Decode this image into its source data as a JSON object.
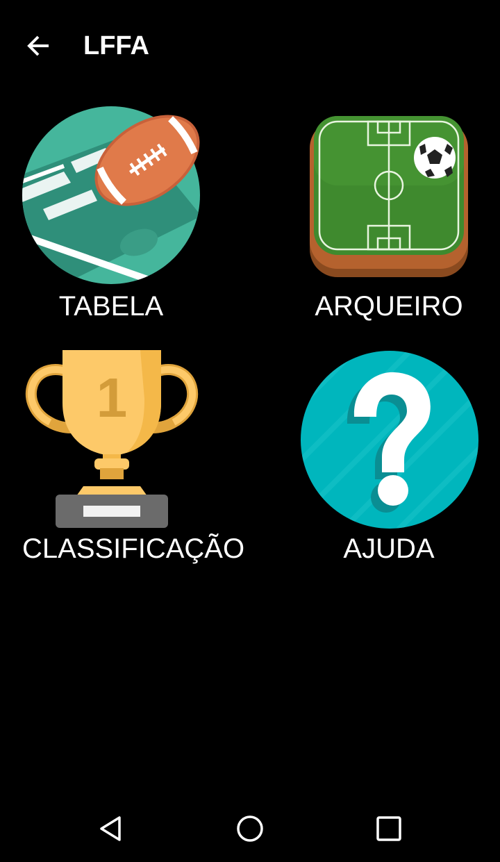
{
  "header": {
    "title": "LFFA",
    "back_icon": "arrow-left-icon"
  },
  "menu": {
    "items": [
      {
        "label": "TABELA",
        "icon": "american-football-icon"
      },
      {
        "label": "ARQUEIRO",
        "icon": "soccer-field-icon"
      },
      {
        "label": "CLASSIFICAÇÃO",
        "icon": "trophy-icon"
      },
      {
        "label": "AJUDA",
        "icon": "help-question-icon"
      }
    ]
  },
  "trophy_number": "1",
  "navbar": {
    "back_icon": "nav-back-triangle-icon",
    "home_icon": "nav-home-circle-icon",
    "recents_icon": "nav-recents-square-icon"
  },
  "colors": {
    "background": "#000000",
    "football_circle": "#45b69c",
    "football_ball": "#e07a4a",
    "field_green": "#3f8a2e",
    "field_frame": "#b5622e",
    "trophy_gold": "#fdc969",
    "trophy_dark": "#e0a43c",
    "trophy_base": "#6b6b6b",
    "help_teal": "#00b6bd"
  }
}
